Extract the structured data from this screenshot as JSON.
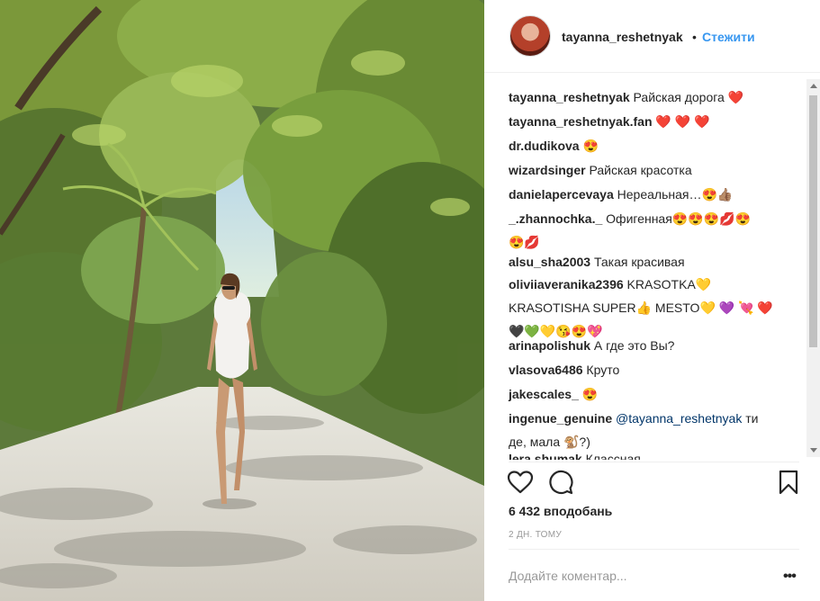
{
  "header": {
    "username": "tayanna_reshetnyak",
    "separator": "•",
    "follow_label": "Стежити"
  },
  "comments": [
    {
      "user": "tayanna_reshetnyak",
      "text": "Райская дорога ❤️"
    },
    {
      "user": "tayanna_reshetnyak.fan",
      "text": "❤️ ❤️ ❤️"
    },
    {
      "user": "dr.dudikova",
      "text": "😍"
    },
    {
      "user": "wizardsinger",
      "text": "Райская красотка"
    },
    {
      "user": "danielapercevaya",
      "text": "Нереальная…😍👍🏽"
    },
    {
      "user": "_.zhannochka._",
      "text": "Офигенная😍😍😍💋😍",
      "text2": "😍💋"
    },
    {
      "user": "alsu_sha2003",
      "text": "Такая красивая"
    },
    {
      "user": "oliviiaveranika2396",
      "text": "KRASOTKA💛",
      "text2": "KRASOTISHA SUPER👍 MESTO💛 💜 💘 ❤️",
      "text3": "🖤💚💛😘😍💖"
    },
    {
      "user": "arinapolishuk",
      "text": "А где это Вы?"
    },
    {
      "user": "vlasova6486",
      "text": "Круто"
    },
    {
      "user": "jakescales_",
      "text": "😍"
    },
    {
      "user": "ingenue_genuine",
      "mention": "@tayanna_reshetnyak",
      "text": "ти",
      "text2": "де, мала 🐒?)"
    },
    {
      "user": "lera.shumak",
      "text": "Классная"
    }
  ],
  "likes": "6 432 вподобань",
  "time": "2 ДН. ТОМУ",
  "add_comment_placeholder": "Додайте коментар...",
  "more_label": "•••",
  "icons": {
    "like": "heart-outline-icon",
    "comment": "speech-bubble-icon",
    "save": "bookmark-icon",
    "more": "ellipsis-icon"
  },
  "colors": {
    "link": "#3897f0",
    "text": "#262626",
    "muted": "#999999"
  }
}
